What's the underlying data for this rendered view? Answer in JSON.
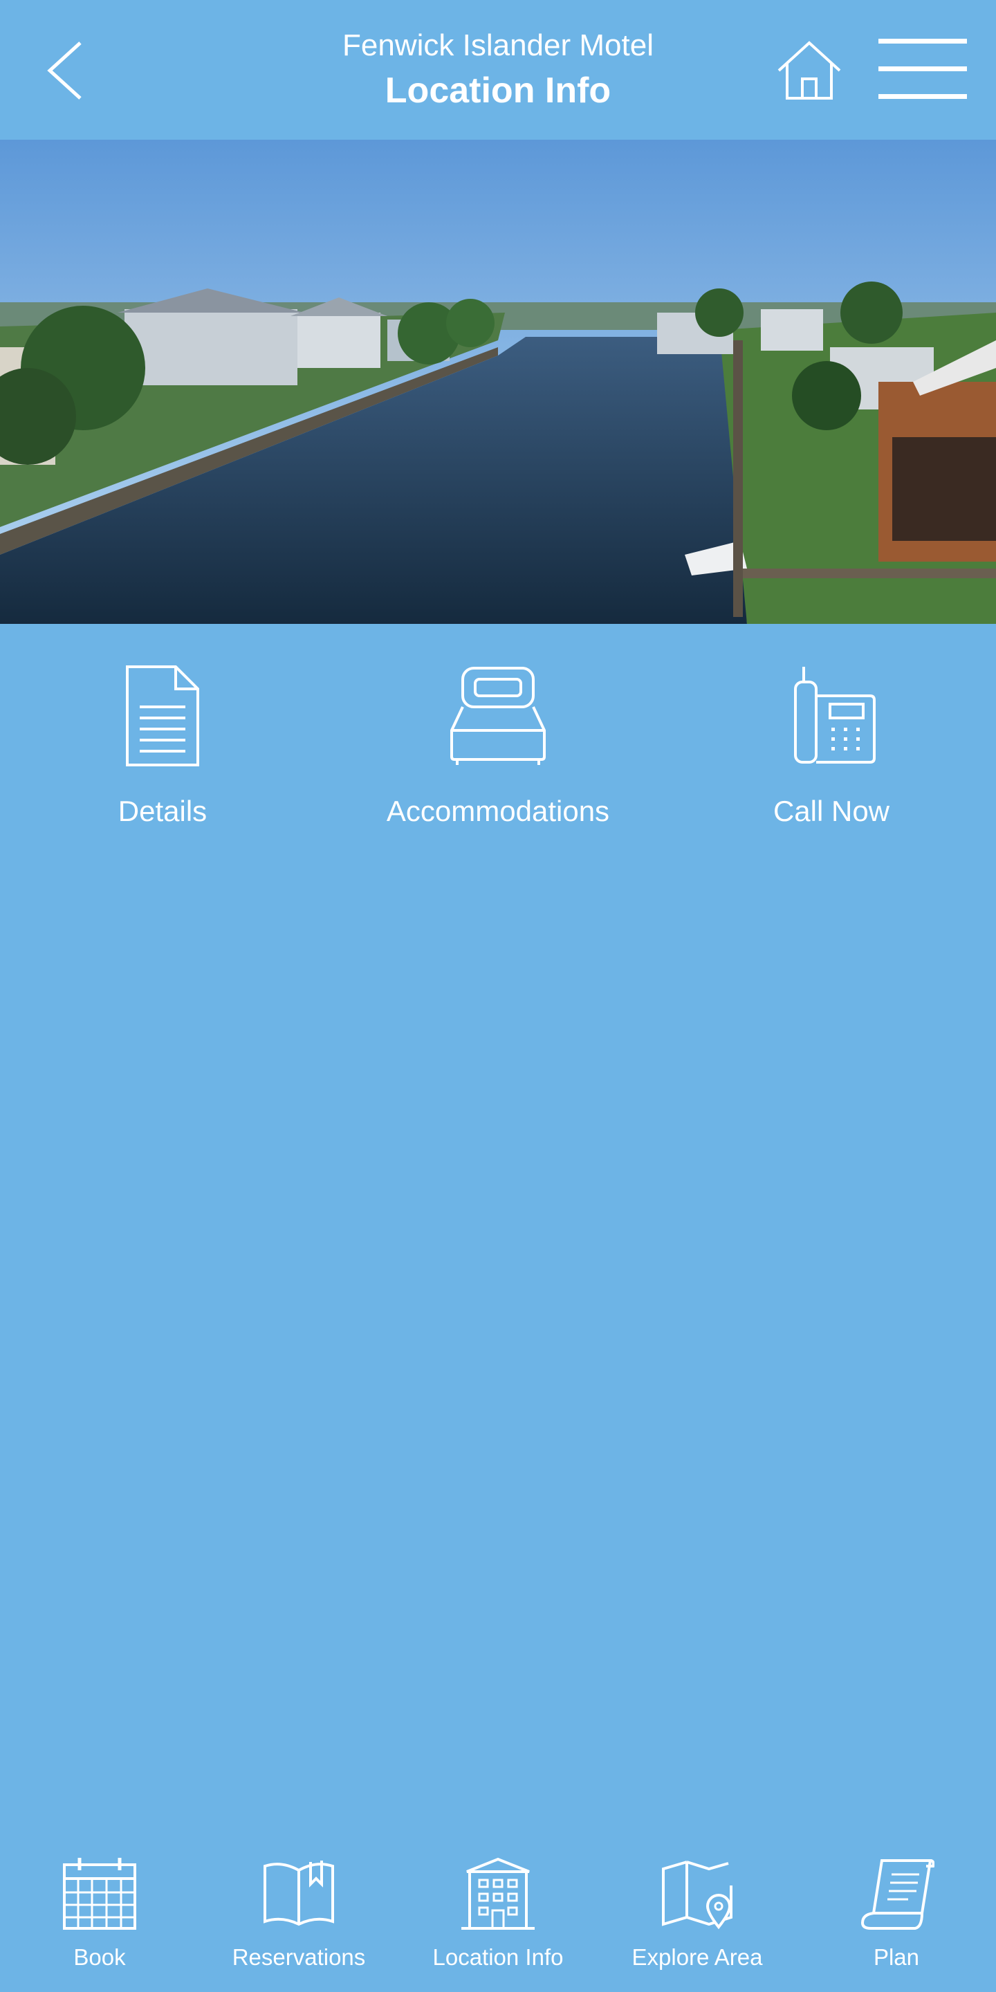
{
  "header": {
    "subtitle": "Fenwick Islander Motel",
    "title": "Location Info",
    "back_icon": "chevron-left-icon",
    "home_icon": "home-icon",
    "menu_icon": "hamburger-menu-icon"
  },
  "hero": {
    "image_subject": "canal-with-waterfront-houses-photo"
  },
  "actions": [
    {
      "label": "Details",
      "icon": "document-icon"
    },
    {
      "label": "Accommodations",
      "icon": "bed-icon"
    },
    {
      "label": "Call Now",
      "icon": "phone-icon"
    }
  ],
  "tabbar": {
    "items": [
      {
        "label": "Book",
        "icon": "calendar-icon"
      },
      {
        "label": "Reservations",
        "icon": "open-book-icon"
      },
      {
        "label": "Location Info",
        "icon": "building-icon"
      },
      {
        "label": "Explore Area",
        "icon": "map-pin-icon"
      },
      {
        "label": "Plan",
        "icon": "scroll-icon"
      }
    ]
  },
  "colors": {
    "background": "#6db4e6",
    "foreground": "#ffffff"
  }
}
